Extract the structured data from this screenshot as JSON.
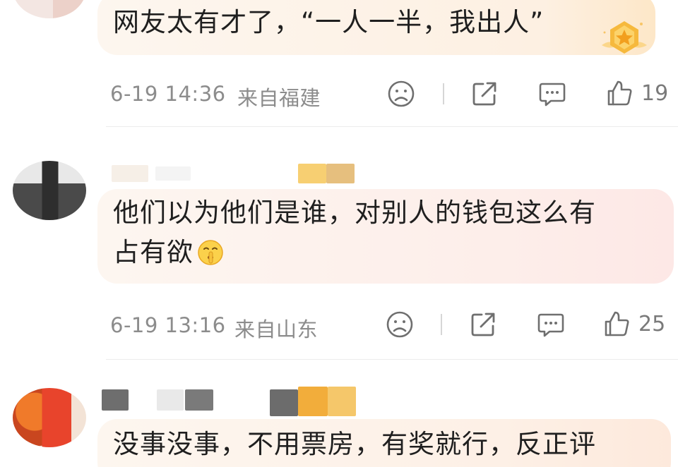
{
  "comments": [
    {
      "text": "网友太有才了，“一人一半，我出人”",
      "time": "6-19 14:36",
      "location": "来自福建",
      "likes": "19"
    },
    {
      "text_line1": "他们以为他们是谁，对别人的钱包这么有",
      "text_line2": "占有欲",
      "time": "6-19 13:16",
      "location": "来自山东",
      "likes": "25"
    },
    {
      "text": "没事没事，不用票房，有奖就行，反正评"
    }
  ],
  "icons": {
    "dislike": "sad-face-icon",
    "share": "share-icon",
    "reply": "comment-icon",
    "like": "thumbs-up-icon",
    "badge": "gold-star-badge-icon",
    "emoji": "shush-emoji-icon"
  },
  "colors": {
    "bubble_warm": "#fdf1e7",
    "bubble_pink": "#fdecec",
    "meta_gray": "#8c8c8c",
    "gold": "#f5b941"
  }
}
